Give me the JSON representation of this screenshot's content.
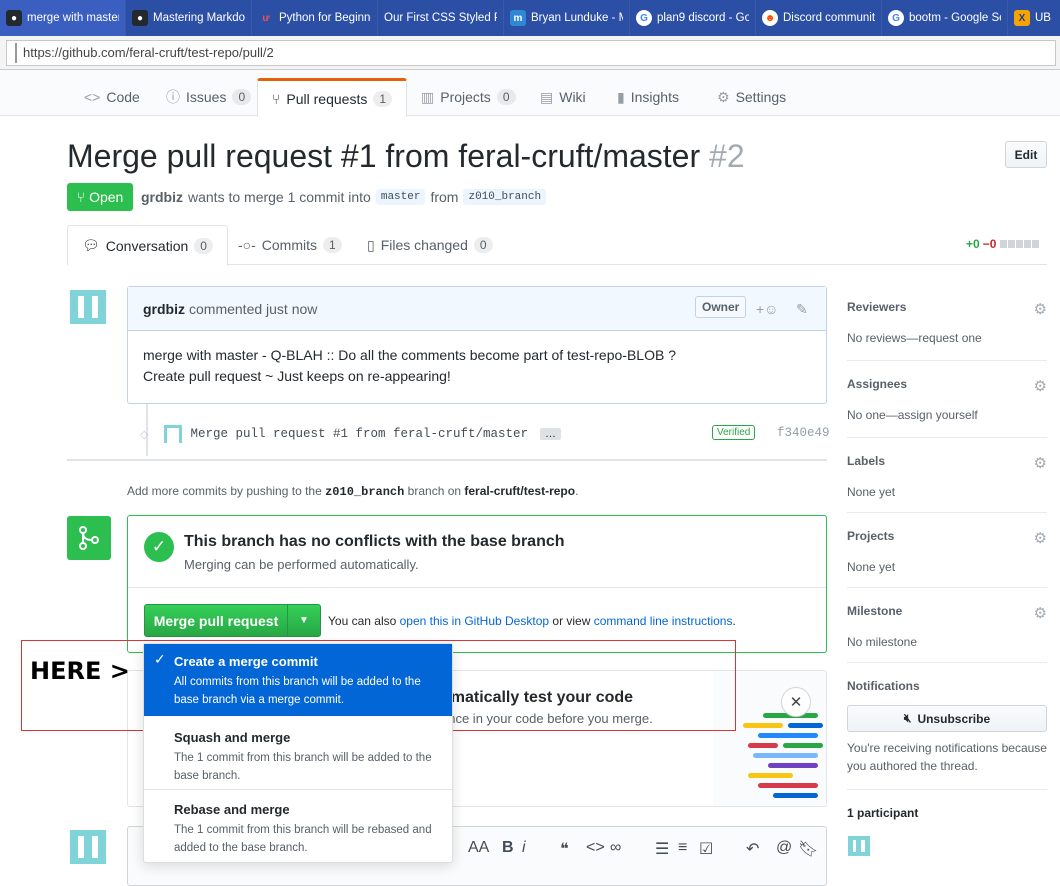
{
  "browser": {
    "tabs": [
      {
        "title": "merge with master",
        "icon": "github-icon",
        "color": "#24292e"
      },
      {
        "title": "Mastering Markdown",
        "icon": "github-icon",
        "color": "#24292e"
      },
      {
        "title": "Python for Beginners",
        "icon": "udemy-icon",
        "color": "#ec5252"
      },
      {
        "title": "Our First CSS Styled Page",
        "icon": "",
        "color": "#2c4fa6"
      },
      {
        "title": "Bryan Lunduke - M",
        "icon": "mastodon-icon",
        "color": "#3088d4"
      },
      {
        "title": "plan9 discord - Go",
        "icon": "google-icon",
        "color": "#fff"
      },
      {
        "title": "Discord community",
        "icon": "reddit-icon",
        "color": "#fff"
      },
      {
        "title": "bootm - Google Se",
        "icon": "google-icon",
        "color": "#fff"
      },
      {
        "title": "UB",
        "icon": "xda-icon",
        "color": "#f5a300"
      }
    ],
    "url": "https://github.com/feral-cruft/test-repo/pull/2"
  },
  "repo_nav": {
    "code": "Code",
    "issues": "Issues",
    "issues_count": "0",
    "pull_requests": "Pull requests",
    "pull_requests_count": "1",
    "projects": "Projects",
    "projects_count": "0",
    "wiki": "Wiki",
    "insights": "Insights",
    "settings": "Settings"
  },
  "pr": {
    "title": "Merge pull request #1 from feral-cruft/master",
    "number": "#2",
    "edit": "Edit",
    "state": "Open",
    "author": "grdbiz",
    "meta_text": "wants to merge 1 commit into",
    "base_branch": "master",
    "from_word": "from",
    "head_branch": "z010_branch"
  },
  "pr_tabs": {
    "conversation": "Conversation",
    "conversation_count": "0",
    "commits": "Commits",
    "commits_count": "1",
    "files": "Files changed",
    "files_count": "0",
    "added": "+0",
    "deleted": "−0"
  },
  "comment": {
    "author": "grdbiz",
    "when": "commented just now",
    "role": "Owner",
    "line1": "merge with master - Q-BLAH :: Do all the comments become part of test-repo-BLOB ?",
    "line2": "Create pull request ~ Just keeps on re-appearing!"
  },
  "commit": {
    "message": "Merge pull request #1 from feral-cruft/master",
    "ellipsis": "…",
    "verified": "Verified",
    "sha": "f340e49"
  },
  "push_note": {
    "prefix": "Add more commits by pushing to the",
    "branch": "z010_branch",
    "middle": "branch on",
    "repo": "feral-cruft/test-repo",
    "suffix": "."
  },
  "merge": {
    "title": "This branch has no conflicts with the base branch",
    "subtitle": "Merging can be performed automatically.",
    "button": "Merge pull request",
    "alt_prefix": "You can also",
    "alt_link1": "open this in GitHub Desktop",
    "alt_middle": "or view",
    "alt_link2": "command line instructions",
    "alt_suffix": "."
  },
  "ci": {
    "title": "omatically test your code",
    "subtitle": "ence in your code before you merge."
  },
  "dropdown": {
    "items": [
      {
        "title": "Create a merge commit",
        "desc": "All commits from this branch will be added to the base branch via a merge commit.",
        "selected": true
      },
      {
        "title": "Squash and merge",
        "desc": "The 1 commit from this branch will be added to the base branch.",
        "selected": false
      },
      {
        "title": "Rebase and merge",
        "desc": "The 1 commit from this branch will be rebased and added to the base branch.",
        "selected": false
      }
    ]
  },
  "annotation": {
    "label": "HERE >"
  },
  "composer": {
    "aa": "AA",
    "bold": "B",
    "italic": "i"
  },
  "sidebar": {
    "reviewers": {
      "label": "Reviewers",
      "value": "No reviews—request one"
    },
    "assignees": {
      "label": "Assignees",
      "value": "No one—assign yourself"
    },
    "labels": {
      "label": "Labels",
      "value": "None yet"
    },
    "projects": {
      "label": "Projects",
      "value": "None yet"
    },
    "milestone": {
      "label": "Milestone",
      "value": "No milestone"
    },
    "notifications": {
      "label": "Notifications",
      "button": "Unsubscribe",
      "reason": "You're receiving notifications because you authored the thread."
    },
    "participants": "1 participant"
  }
}
